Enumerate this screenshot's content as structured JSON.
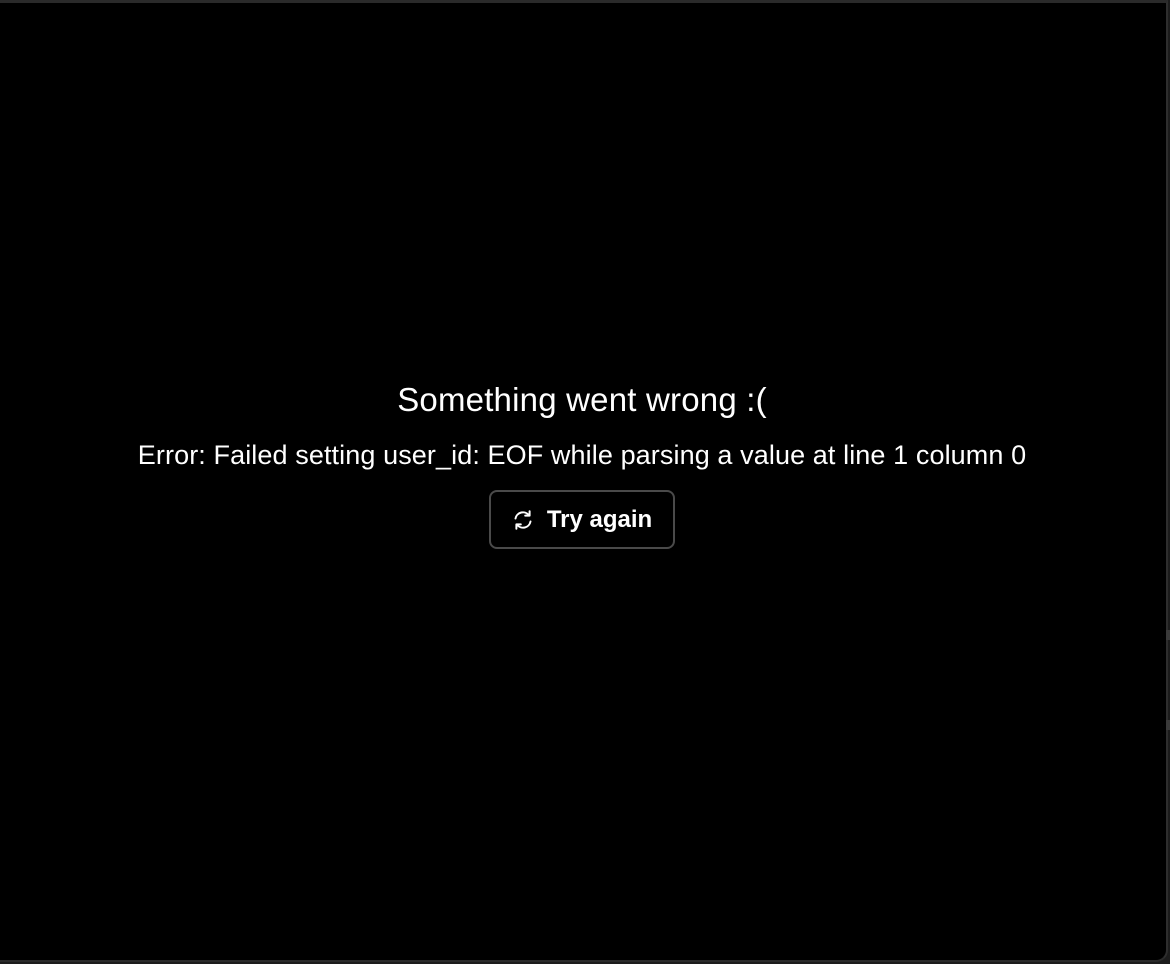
{
  "error": {
    "title": "Something went wrong :(",
    "message": "Error: Failed setting user_id: EOF while parsing a value at line 1 column 0",
    "retry_button": {
      "label": "Try again",
      "icon": "refresh-icon"
    }
  },
  "colors": {
    "background": "#000000",
    "text": "#ffffff",
    "button_border": "#4a4a4a"
  }
}
